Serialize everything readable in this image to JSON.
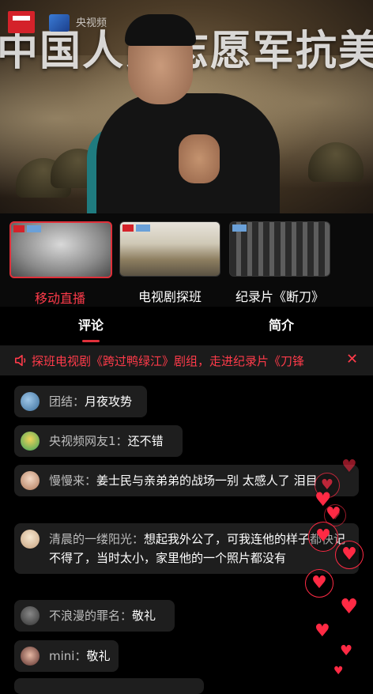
{
  "video": {
    "bg_title": "中国人民志愿军抗美",
    "brand": "央视频"
  },
  "channels": [
    {
      "label": "移动直播",
      "active": true
    },
    {
      "label": "电视剧探班",
      "active": false
    },
    {
      "label": "纪录片《断刀》",
      "active": false
    }
  ],
  "tabs": {
    "comments": "评论",
    "intro": "简介"
  },
  "marquee": {
    "text": "探班电视剧《跨过鸭绿江》剧组，走进纪录片《刀锋",
    "close_glyph": "✕"
  },
  "comments": [
    {
      "name": "团结",
      "sep": "：",
      "text": "月夜攻势"
    },
    {
      "name": "央视频网友1",
      "sep": "：",
      "text": "还不错"
    },
    {
      "name": "慢慢来",
      "sep": "：",
      "text": "姜士民与亲弟弟的战场一别 太感人了 泪目"
    },
    {
      "name": "清晨的一缕阳光",
      "sep": "：",
      "text": "想起我外公了，可我连他的样子都快记不得了，当时太小，家里他的一个照片都没有"
    },
    {
      "name": "不浪漫的罪名",
      "sep": "：",
      "text": "敬礼"
    },
    {
      "name": "mini",
      "sep": "：",
      "text": "敬礼"
    }
  ],
  "icons": {
    "speaker": "speaker-icon",
    "heart": "heart-icon"
  },
  "colors": {
    "accent": "#e0303a",
    "accent_text": "#ff3b4a",
    "comment_bg": "#1e1e1e"
  }
}
